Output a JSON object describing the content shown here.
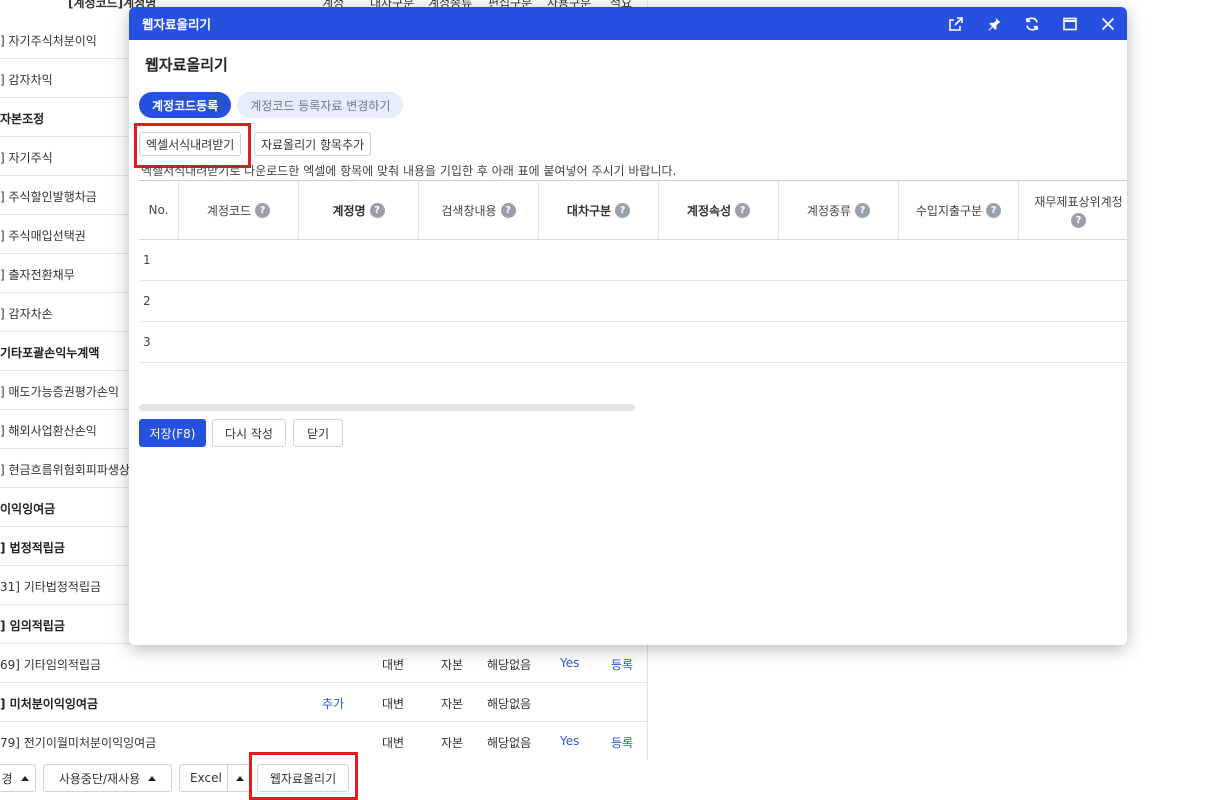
{
  "background_table": {
    "header": {
      "name_col": "[계정코드]계정명",
      "c1": "계정",
      "c2": "대차구분",
      "c3": "계정종류",
      "c4": "편집구분",
      "c5": "사용구분",
      "c6": "적요"
    },
    "rows": [
      {
        "name": "] 자기주식처분이익",
        "bold": false
      },
      {
        "name": "] 감자차익",
        "bold": false
      },
      {
        "name": "자본조정",
        "bold": true
      },
      {
        "name": "] 자기주식",
        "bold": false
      },
      {
        "name": "] 주식할인발행차금",
        "bold": false
      },
      {
        "name": "] 주식매입선택권",
        "bold": false
      },
      {
        "name": "] 출자전환채무",
        "bold": false
      },
      {
        "name": "] 감자차손",
        "bold": false
      },
      {
        "name": "기타포괄손익누계액",
        "bold": true
      },
      {
        "name": "] 매도가능증권평가손익",
        "bold": false
      },
      {
        "name": "] 해외사업환산손익",
        "bold": false
      },
      {
        "name": "] 현금흐름위험회피파생상품평가손익",
        "bold": false
      },
      {
        "name": "이익잉여금",
        "bold": true
      },
      {
        "name": "] 법정적립금",
        "bold": true
      },
      {
        "name": "31] 기타법정적립금",
        "bold": false
      },
      {
        "name": "] 임의적립금",
        "bold": true
      },
      {
        "name": "69] 기타임의적립금",
        "bold": false,
        "c2": "대변",
        "c3": "자본",
        "c4": "해당없음",
        "c5": "Yes",
        "c6": "등록"
      },
      {
        "name": "] 미처분이익잉여금",
        "bold": true,
        "c1": "추가",
        "c2": "대변",
        "c3": "자본",
        "c4": "해당없음"
      },
      {
        "name": "79] 전기이월미처분이익잉여금",
        "bold": false,
        "c2": "대변",
        "c3": "자본",
        "c4": "해당없음",
        "c5": "Yes",
        "c6": "등록"
      }
    ]
  },
  "bottom_toolbar": {
    "partial_label": "경",
    "stop_resume_label": "사용중단/재사용",
    "excel_label": "Excel",
    "web_upload_label": "웹자료올리기"
  },
  "dialog": {
    "title": "웹자료올리기",
    "heading": "웹자료올리기",
    "tabs": [
      {
        "label": "계정코드등록",
        "active": true
      },
      {
        "label": "계정코드 등록자료 변경하기",
        "active": false
      }
    ],
    "excel_download_label": "엑셀서식내려받기",
    "add_item_label": "자료올리기 항목추가",
    "instruction": "엑셀서식내려받기로 다운로드한 엑셀에 항목에 맞춰 내용을 기입한 후 아래 표에 붙여넣어 주시기 바랍니다.",
    "columns": [
      {
        "label": "No.",
        "help": false,
        "bold": false
      },
      {
        "label": "계정코드",
        "help": true,
        "bold": false
      },
      {
        "label": "계정명",
        "help": true,
        "bold": true
      },
      {
        "label": "검색창내용",
        "help": true,
        "bold": false
      },
      {
        "label": "대차구분",
        "help": true,
        "bold": true
      },
      {
        "label": "계정속성",
        "help": true,
        "bold": true
      },
      {
        "label": "계정종류",
        "help": true,
        "bold": false
      },
      {
        "label": "수입지출구분",
        "help": true,
        "bold": false
      },
      {
        "label": "재무제표상위계정",
        "help": true,
        "bold": false
      }
    ],
    "rows": [
      "1",
      "2",
      "3"
    ],
    "save_label": "저장(F8)",
    "rewrite_label": "다시 작성",
    "close_label": "닫기",
    "help_glyph": "?"
  },
  "colors": {
    "accent": "#2650e0",
    "highlight": "#e01c1c",
    "tab_inactive_bg": "#e6ecfb"
  }
}
